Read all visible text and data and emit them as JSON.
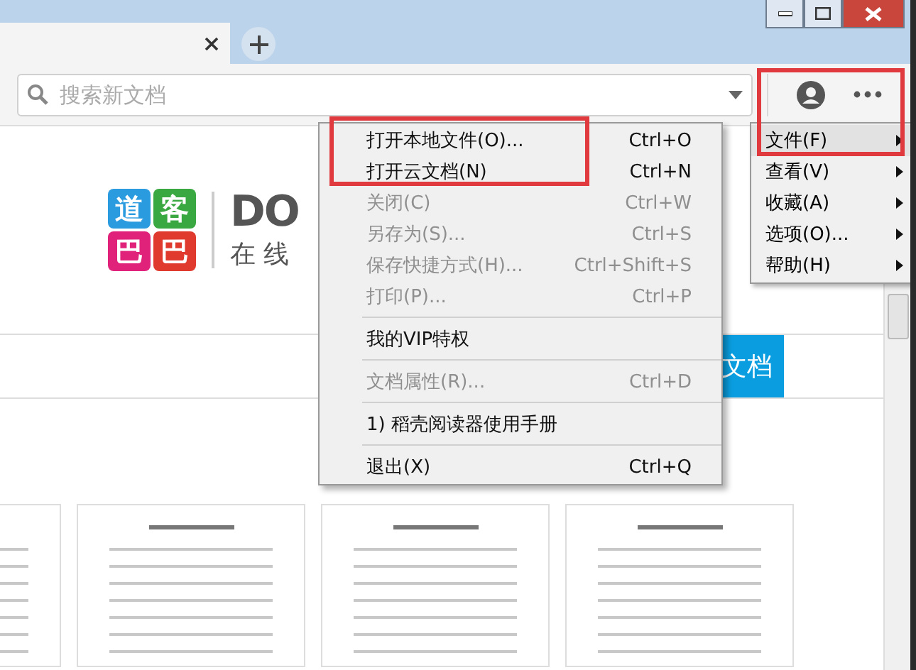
{
  "search": {
    "placeholder": "搜索新文档"
  },
  "logo": {
    "tiles": [
      {
        "text": "道",
        "color": "#2b9be0"
      },
      {
        "text": "客",
        "color": "#3aa840"
      },
      {
        "text": "巴",
        "color": "#e0227a"
      },
      {
        "text": "巴",
        "color": "#e0392e"
      }
    ],
    "brand": "DO",
    "tagline": "在 线"
  },
  "banner_button": "文档",
  "main_menu": [
    {
      "label": "文件(F)",
      "selected": true
    },
    {
      "label": "查看(V)",
      "selected": false
    },
    {
      "label": "收藏(A)",
      "selected": false
    },
    {
      "label": "选项(O)...",
      "selected": false
    },
    {
      "label": "帮助(H)",
      "selected": false
    }
  ],
  "file_menu": [
    {
      "kind": "item",
      "label": "打开本地文件(O)...",
      "shortcut": "Ctrl+O",
      "disabled": false
    },
    {
      "kind": "item",
      "label": "打开云文档(N)",
      "shortcut": "Ctrl+N",
      "disabled": false
    },
    {
      "kind": "item",
      "label": "关闭(C)",
      "shortcut": "Ctrl+W",
      "disabled": true
    },
    {
      "kind": "item",
      "label": "另存为(S)...",
      "shortcut": "Ctrl+S",
      "disabled": true
    },
    {
      "kind": "item",
      "label": "保存快捷方式(H)...",
      "shortcut": "Ctrl+Shift+S",
      "disabled": true
    },
    {
      "kind": "item",
      "label": "打印(P)...",
      "shortcut": "Ctrl+P",
      "disabled": true
    },
    {
      "kind": "separator"
    },
    {
      "kind": "item",
      "label": "我的VIP特权",
      "disabled": false
    },
    {
      "kind": "separator"
    },
    {
      "kind": "item",
      "label": "文档属性(R)...",
      "shortcut": "Ctrl+D",
      "disabled": true
    },
    {
      "kind": "separator"
    },
    {
      "kind": "item",
      "label": "1) 稻壳阅读器使用手册",
      "disabled": false
    },
    {
      "kind": "separator"
    },
    {
      "kind": "item",
      "label": "退出(X)",
      "shortcut": "Ctrl+Q",
      "disabled": false
    }
  ]
}
